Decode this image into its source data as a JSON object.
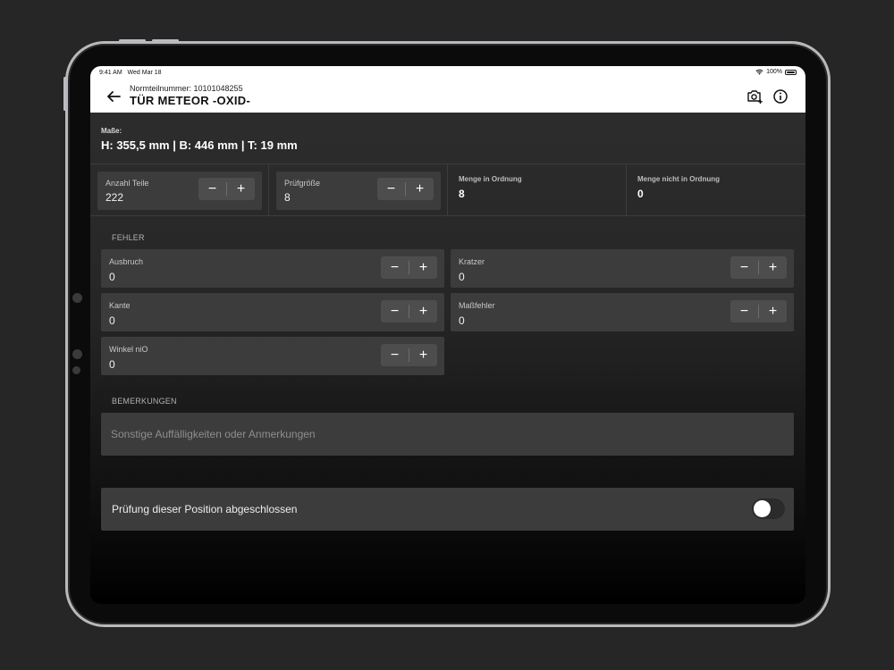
{
  "status": {
    "time": "9:41 AM",
    "date": "Wed Mar 18",
    "battery": "100%"
  },
  "header": {
    "subtitle": "Normteilnummer: 10101048255",
    "title": "TÜR METEOR  -OXID-",
    "icons": [
      "back-arrow-icon",
      "camera-add-icon",
      "info-icon"
    ]
  },
  "dimensions": {
    "label": "Maße:",
    "value": "H: 355,5 mm | B: 446 mm | T: 19 mm"
  },
  "counts": {
    "anzahl_teile": {
      "label": "Anzahl Teile",
      "value": "222"
    },
    "pruefgroesse": {
      "label": "Prüfgröße",
      "value": "8"
    },
    "menge_in_ordnung": {
      "label": "Menge in Ordnung",
      "value": "8"
    },
    "menge_nicht_in_ordnung": {
      "label": "Menge nicht in Ordnung",
      "value": "0"
    }
  },
  "stepper": {
    "minus": "−",
    "plus": "+"
  },
  "fehler": {
    "label": "FEHLER",
    "items": [
      {
        "label": "Ausbruch",
        "value": "0"
      },
      {
        "label": "Kratzer",
        "value": "0"
      },
      {
        "label": "Kante",
        "value": "0"
      },
      {
        "label": "Maßfehler",
        "value": "0"
      },
      {
        "label": "Winkel niO",
        "value": "0"
      }
    ]
  },
  "bemerkungen": {
    "label": "BEMERKUNGEN",
    "placeholder": "Sonstige Auffälligkeiten oder Anmerkungen",
    "value": ""
  },
  "completion": {
    "label": "Prüfung dieser Position abgeschlossen",
    "checked": false
  },
  "colors": {
    "background": "#262626",
    "field": "#3c3c3c",
    "stepper": "#4d4d4d",
    "header": "#ffffff"
  }
}
